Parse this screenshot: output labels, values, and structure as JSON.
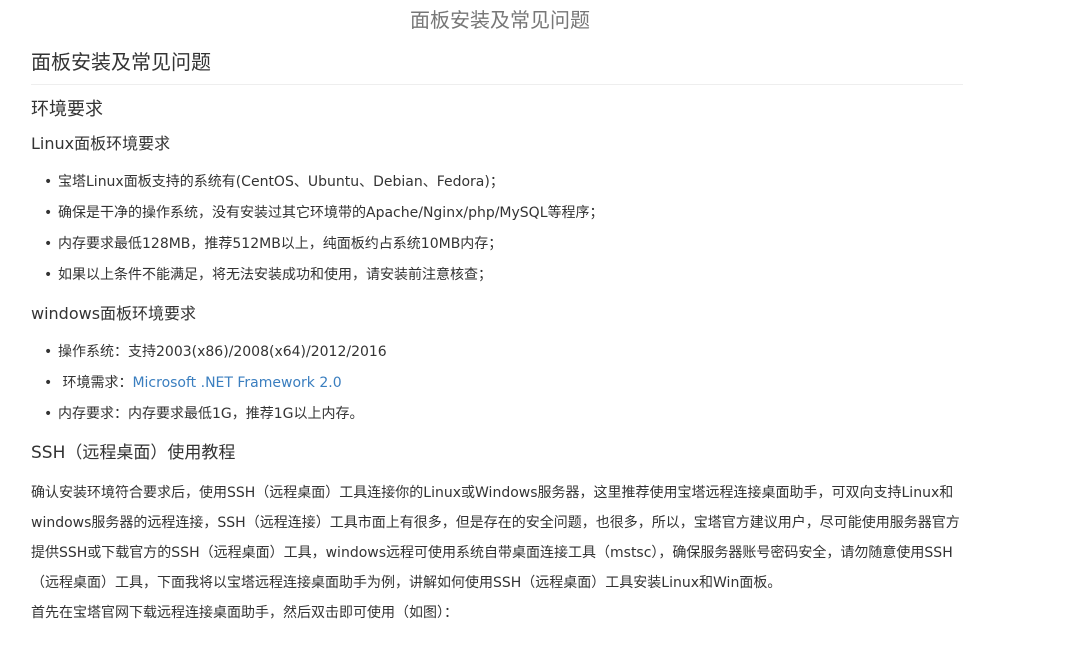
{
  "top_title": "面板安装及常见问题",
  "article": {
    "title": "面板安装及常见问题",
    "env_heading": "环境要求",
    "linux": {
      "heading": "Linux面板环境要求",
      "items": [
        "宝塔Linux面板支持的系统有(CentOS、Ubuntu、Debian、Fedora)；",
        "确保是干净的操作系统，没有安装过其它环境带的Apache/Nginx/php/MySQL等程序；",
        "内存要求最低128MB，推荐512MB以上，纯面板约占系统10MB内存；",
        "如果以上条件不能满足，将无法安装成功和使用，请安装前注意核查；"
      ]
    },
    "windows": {
      "heading": "windows面板环境要求",
      "item1": "操作系统：支持2003(x86)/2008(x64)/2012/2016",
      "item2_prefix": "环境需求：",
      "item2_link": "Microsoft .NET Framework 2.0",
      "item3": "内存要求：内存要求最低1G，推荐1G以上内存。"
    },
    "ssh": {
      "heading": "SSH（远程桌面）使用教程",
      "paragraph": "确认安装环境符合要求后，使用SSH（远程桌面）工具连接你的Linux或Windows服务器，这里推荐使用宝塔远程连接桌面助手，可双向支持Linux和windows服务器的远程连接，SSH（远程连接）工具市面上有很多，但是存在的安全问题，也很多，所以，宝塔官方建议用户，尽可能使用服务器官方提供SSH或下载官方的SSH（远程桌面）工具，windows远程可使用系统自带桌面连接工具（mstsc），确保服务器账号密码安全，请勿随意使用SSH（远程桌面）工具，下面我将以宝塔远程连接桌面助手为例，讲解如何使用SSH（远程桌面）工具安装Linux和Win面板。",
      "paragraph2": "首先在宝塔官网下载远程连接桌面助手，然后双击即可使用（如图）："
    }
  }
}
